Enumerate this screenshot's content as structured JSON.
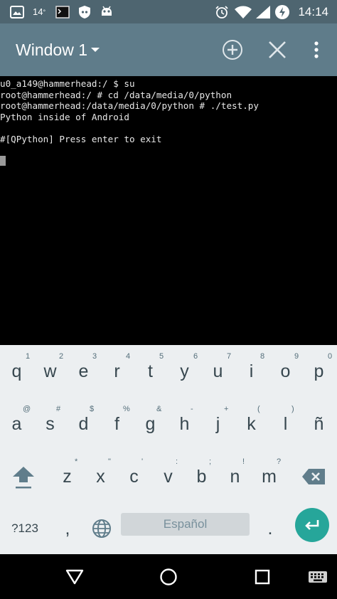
{
  "status_bar": {
    "notification_count": "14",
    "notification_count_suffix": "°",
    "clock": "14:14"
  },
  "action_bar": {
    "title": "Window 1"
  },
  "terminal": {
    "lines": [
      "u0_a149@hammerhead:/ $ su",
      "root@hammerhead:/ # cd /data/media/0/python",
      "root@hammerhead:/data/media/0/python # ./test.py",
      "Python inside of Android",
      "",
      "#[QPython] Press enter to exit"
    ]
  },
  "keyboard": {
    "row1": [
      {
        "key": "q",
        "hint": "1"
      },
      {
        "key": "w",
        "hint": "2"
      },
      {
        "key": "e",
        "hint": "3"
      },
      {
        "key": "r",
        "hint": "4"
      },
      {
        "key": "t",
        "hint": "5"
      },
      {
        "key": "y",
        "hint": "6"
      },
      {
        "key": "u",
        "hint": "7"
      },
      {
        "key": "i",
        "hint": "8"
      },
      {
        "key": "o",
        "hint": "9"
      },
      {
        "key": "p",
        "hint": "0"
      }
    ],
    "row2": [
      {
        "key": "a",
        "hint": "@"
      },
      {
        "key": "s",
        "hint": "#"
      },
      {
        "key": "d",
        "hint": "$"
      },
      {
        "key": "f",
        "hint": "%"
      },
      {
        "key": "g",
        "hint": "&"
      },
      {
        "key": "h",
        "hint": "-"
      },
      {
        "key": "j",
        "hint": "+"
      },
      {
        "key": "k",
        "hint": "("
      },
      {
        "key": "l",
        "hint": ")"
      },
      {
        "key": "ñ",
        "hint": ""
      }
    ],
    "row3": [
      {
        "key": "z",
        "hint": "*"
      },
      {
        "key": "x",
        "hint": "\""
      },
      {
        "key": "c",
        "hint": "'"
      },
      {
        "key": "v",
        "hint": ":"
      },
      {
        "key": "b",
        "hint": ";"
      },
      {
        "key": "n",
        "hint": "!"
      },
      {
        "key": "m",
        "hint": "?"
      }
    ],
    "symbols_label": "?123",
    "comma_label": ",",
    "space_label": "Español",
    "period_label": ".",
    "accent_color": "#26a69a"
  },
  "icons": {
    "status": [
      "screenshot-icon",
      "terminal-icon",
      "shield-icon",
      "android-icon",
      "alarm-icon",
      "wifi-icon",
      "signal-icon",
      "data-saver-icon"
    ],
    "action_bar": [
      "dropdown-caret-icon",
      "add-window-icon",
      "close-window-icon",
      "overflow-menu-icon"
    ],
    "keyboard": [
      "shift-icon",
      "globe-icon",
      "backspace-icon",
      "enter-icon"
    ],
    "nav": [
      "back-icon",
      "home-icon",
      "recents-icon",
      "keyboard-switch-icon"
    ]
  }
}
